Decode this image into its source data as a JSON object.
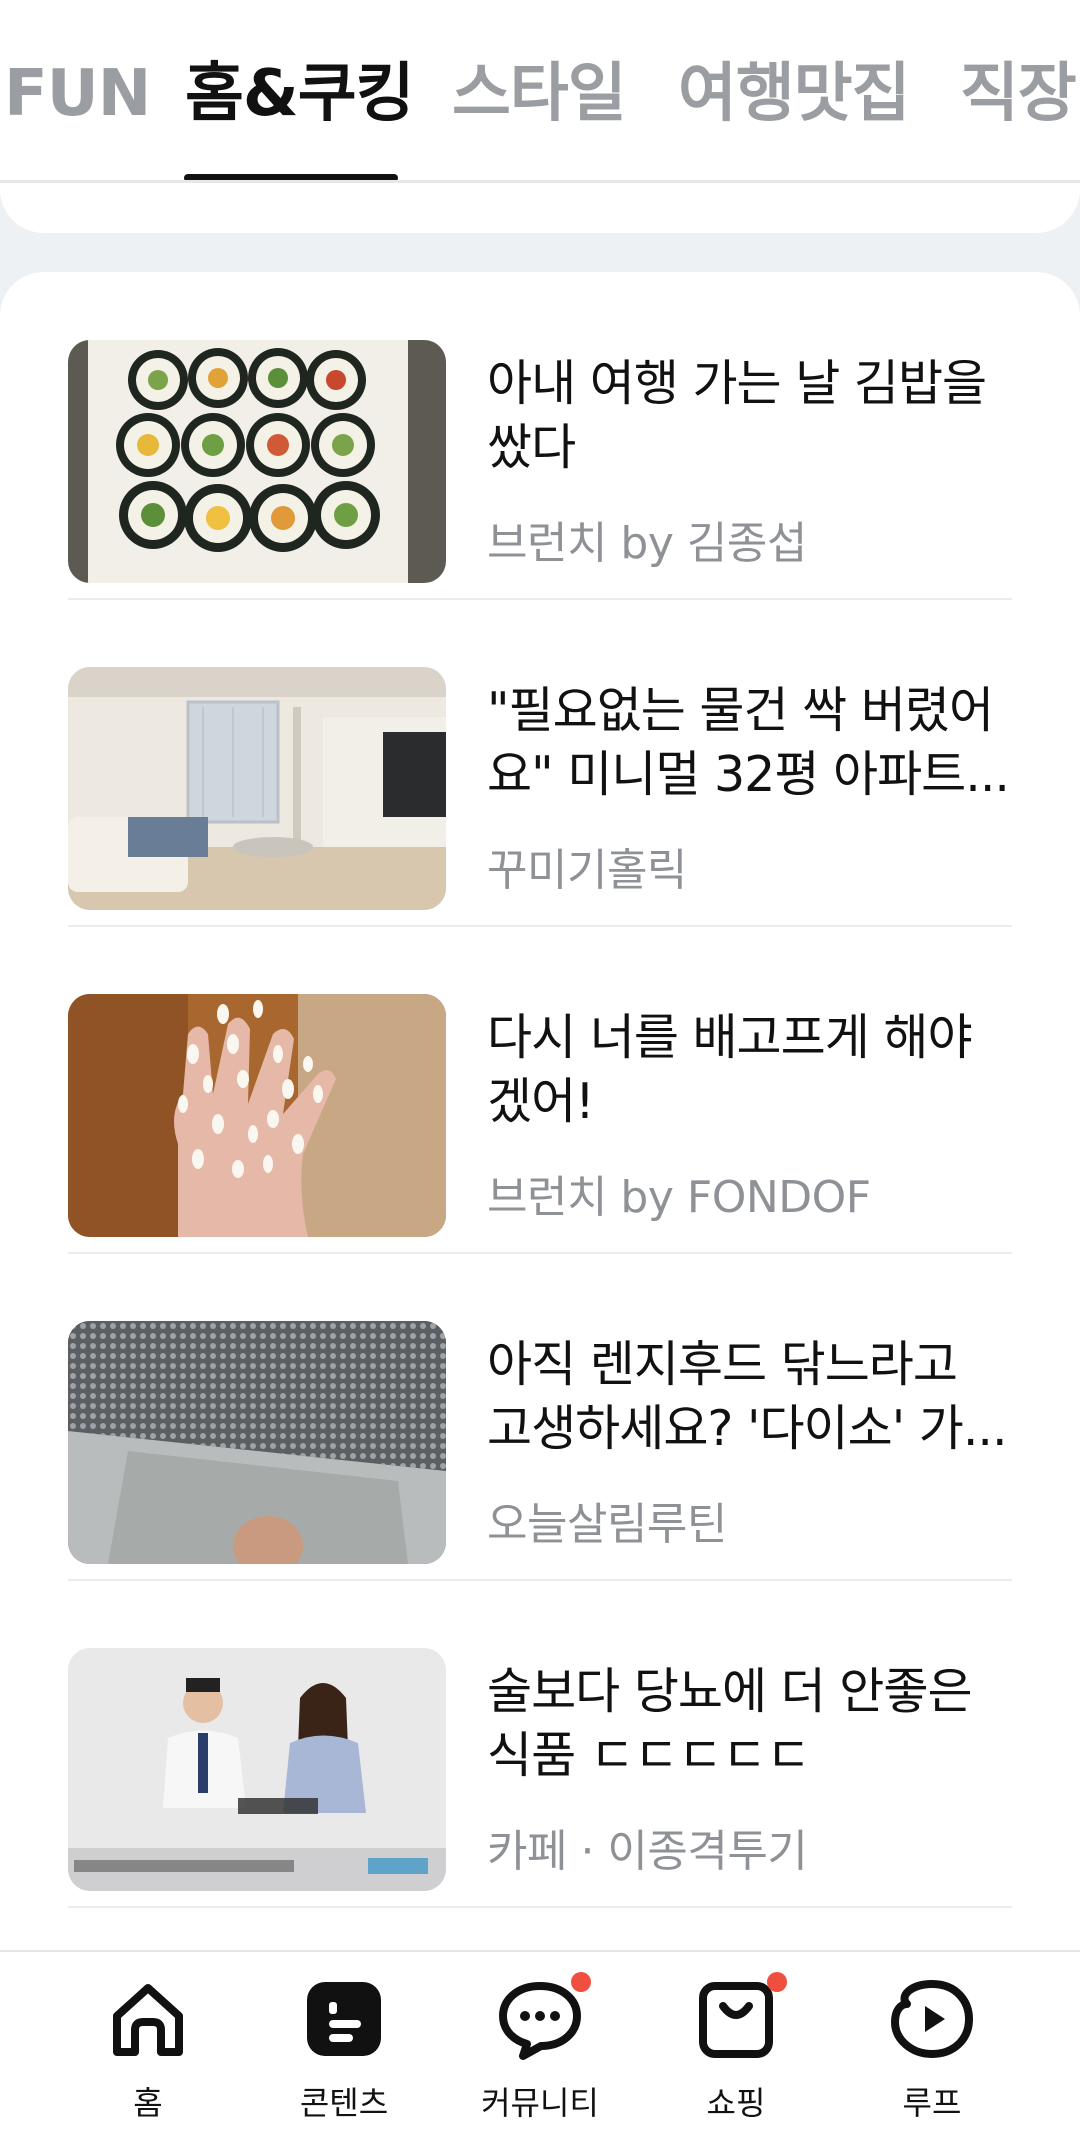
{
  "tabs": [
    {
      "label": "FUN",
      "active": false
    },
    {
      "label": "홈&쿠킹",
      "active": true
    },
    {
      "label": "스타일",
      "active": false
    },
    {
      "label": "여행맛집",
      "active": false
    },
    {
      "label": "직장",
      "active": false
    }
  ],
  "feed": [
    {
      "title": "아내 여행 가는 날 김밥을 쌌다",
      "source": "브런치 by 김종섭",
      "thumb": "kimbap-photo"
    },
    {
      "title": "\"필요없는 물건 싹 버렸어요\" 미니멀 32평 아파트...",
      "source": "꾸미기홀릭",
      "thumb": "living-room-photo"
    },
    {
      "title": "다시 너를 배고프게 해야겠어!",
      "source": "브런치 by FONDOF",
      "thumb": "rice-hand-photo"
    },
    {
      "title": "아직 렌지후드 닦느라고 고생하세요? '다이소' 가...",
      "source": "오늘살림루틴",
      "thumb": "range-hood-filter-photo"
    },
    {
      "title": "술보다 당뇨에 더 안좋은 식품 ㄷㄷㄷㄷㄷ",
      "source": "카페 · 이종격투기",
      "thumb": "doctors-video-still"
    }
  ],
  "bottom_nav": [
    {
      "label": "홈",
      "icon": "home-icon",
      "badge": false
    },
    {
      "label": "콘텐츠",
      "icon": "contents-icon",
      "badge": false
    },
    {
      "label": "커뮤니티",
      "icon": "chat-bubble-icon",
      "badge": true
    },
    {
      "label": "쇼핑",
      "icon": "shopping-bag-icon",
      "badge": true
    },
    {
      "label": "루프",
      "icon": "loop-play-icon",
      "badge": false
    }
  ],
  "colors": {
    "accent_text": "#111111",
    "inactive_tab": "#9a9da2",
    "badge": "#f04e3e",
    "source_text": "#8e9196"
  }
}
